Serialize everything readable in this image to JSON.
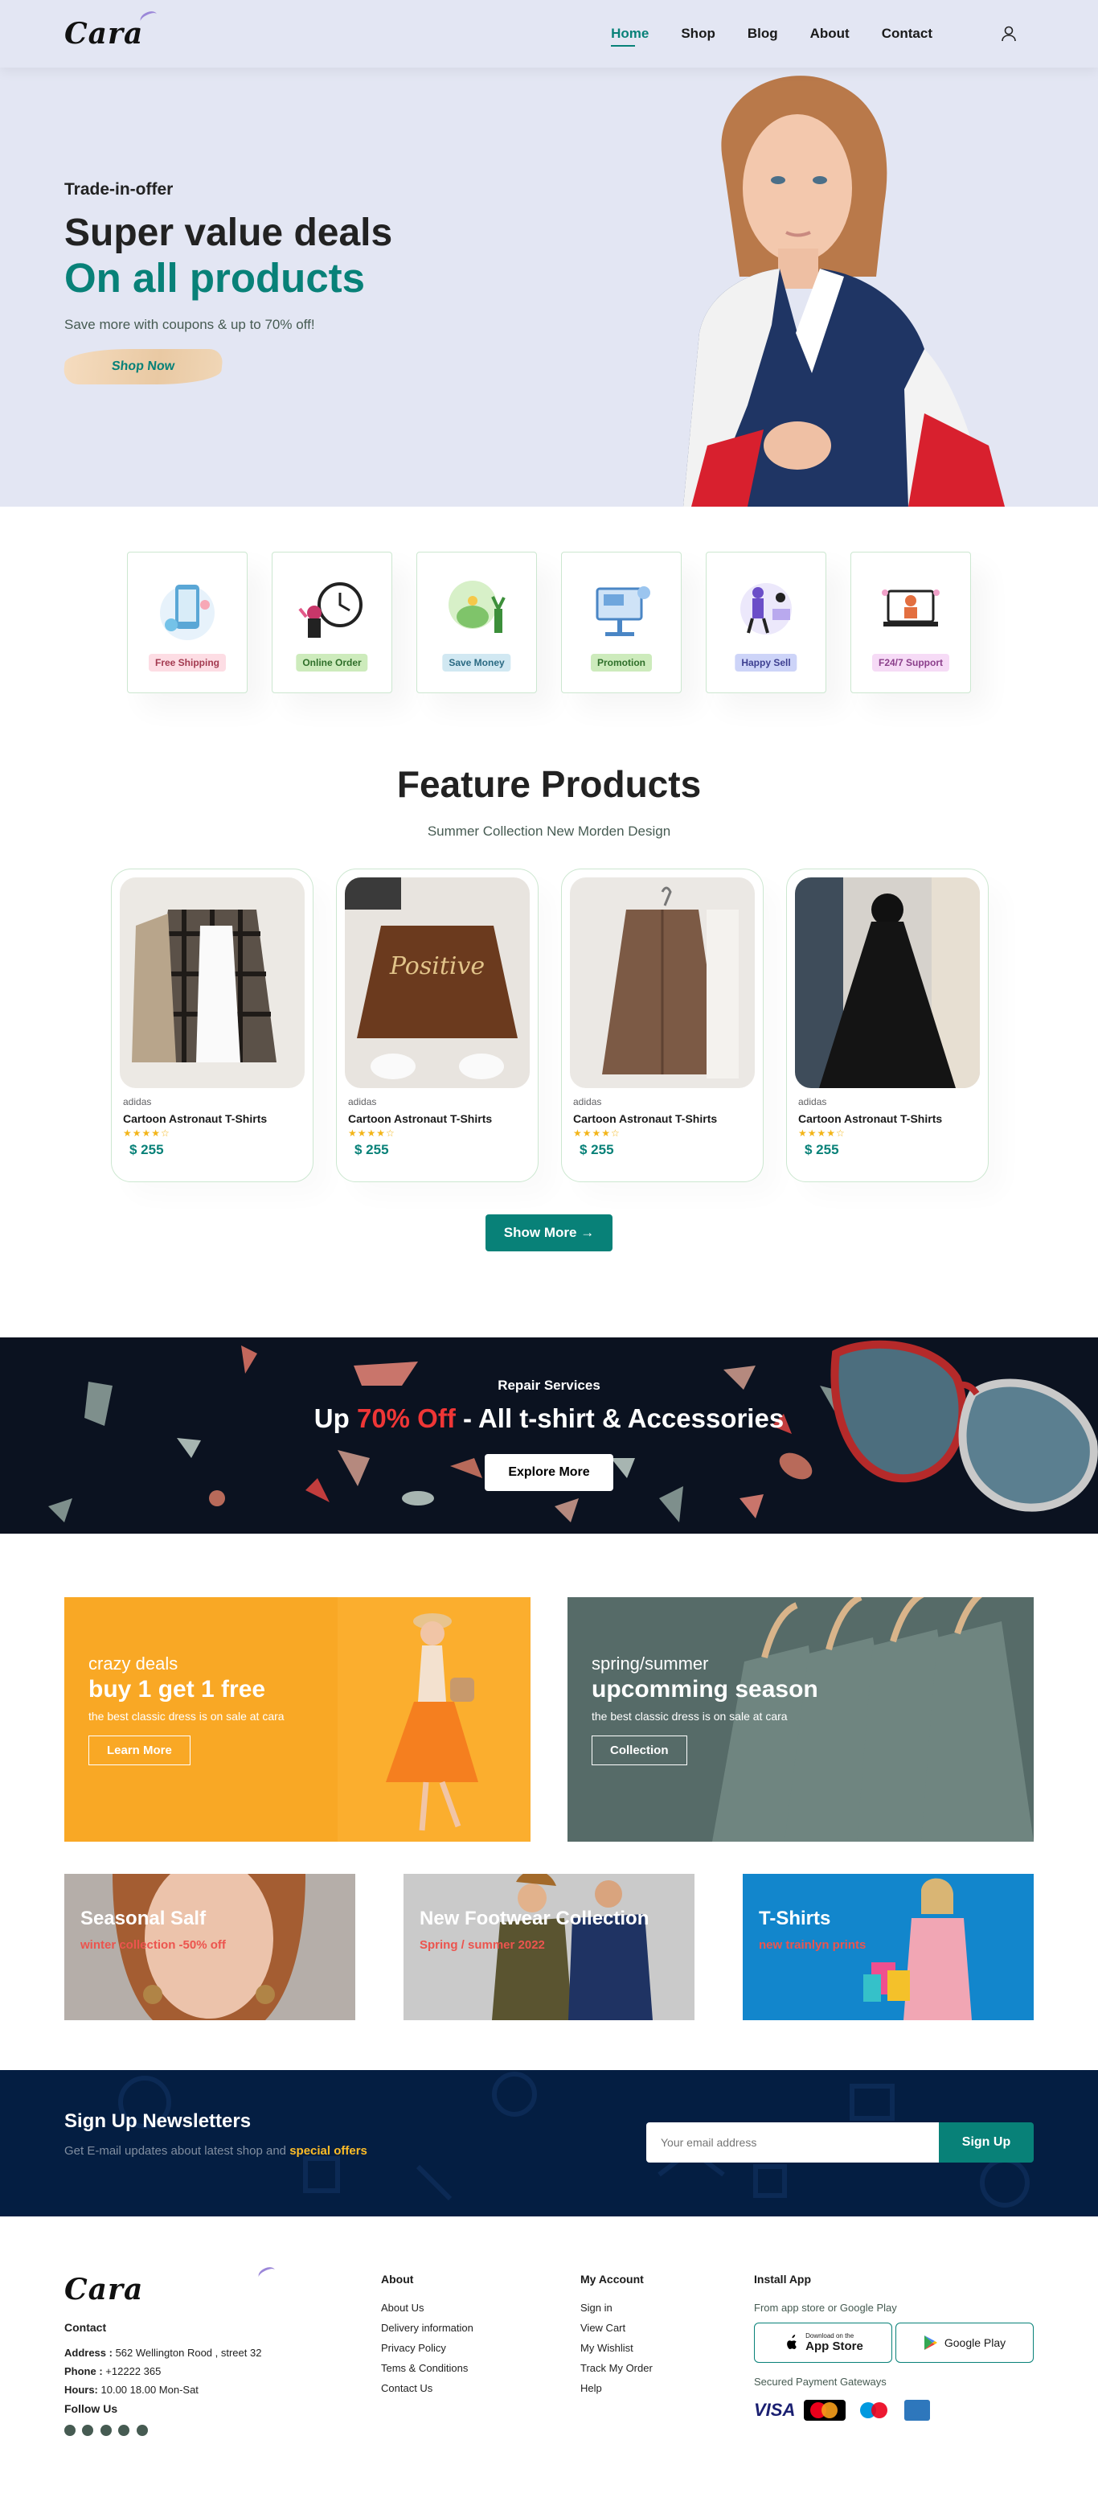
{
  "header": {
    "logo": "Cara",
    "nav": [
      {
        "label": "Home",
        "active": true
      },
      {
        "label": "Shop"
      },
      {
        "label": "Blog"
      },
      {
        "label": "About"
      },
      {
        "label": "Contact"
      }
    ],
    "user_icon": "user-icon"
  },
  "hero": {
    "kicker": "Trade-in-offer",
    "title": "Super value deals",
    "title_accent": "On all products",
    "subtitle": "Save more with coupons & up to 70% off!",
    "cta": "Shop Now"
  },
  "features": [
    {
      "label": "Free Shipping",
      "bg": "#fddde4",
      "icon": "shipping-icon"
    },
    {
      "label": "Online Order",
      "bg": "#cdebbc",
      "icon": "online-order-icon"
    },
    {
      "label": "Save Money",
      "bg": "#d1e8f2",
      "icon": "save-money-icon"
    },
    {
      "label": "Promotion",
      "bg": "#cdebbc",
      "icon": "promotion-icon"
    },
    {
      "label": "Happy Sell",
      "bg": "#cdd4f8",
      "icon": "happy-sell-icon"
    },
    {
      "label": "F24/7 Support",
      "bg": "#f6dbf6",
      "icon": "support-icon"
    }
  ],
  "products_section": {
    "title": "Feature Products",
    "subtitle": "Summer Collection New Morden Design",
    "items": [
      {
        "brand": "adidas",
        "name": "Cartoon Astronaut T-Shirts",
        "rating": 4.5,
        "price": "$ 255",
        "image": "plaid-shirt-image"
      },
      {
        "brand": "adidas",
        "name": "Cartoon Astronaut T-Shirts",
        "rating": 4.5,
        "price": "$ 255",
        "image": "positive-sweatshirt-image",
        "print": "Positive"
      },
      {
        "brand": "adidas",
        "name": "Cartoon Astronaut T-Shirts",
        "rating": 4.5,
        "price": "$ 255",
        "image": "brown-jacket-image"
      },
      {
        "brand": "adidas",
        "name": "Cartoon Astronaut T-Shirts",
        "rating": 4.5,
        "price": "$ 255",
        "image": "black-abaya-image"
      }
    ],
    "stars": "★★★★☆",
    "show_more": "Show More →"
  },
  "banner": {
    "kicker": "Repair Services",
    "title_pre": "Up ",
    "title_accent": "70% Off",
    "title_post": " - All t-shirt & Accessories",
    "cta": "Explore More"
  },
  "sm_banners": [
    {
      "kicker": "crazy deals",
      "title": "buy 1 get 1 free",
      "desc": "the best classic dress is on sale at cara",
      "cta": "Learn More",
      "bg": "#f9a825"
    },
    {
      "kicker": "spring/summer",
      "title": "upcomming season",
      "desc": "the best classic dress is on sale at cara",
      "cta": "Collection",
      "bg": "#5f7370"
    }
  ],
  "banner3": [
    {
      "title": "Seasonal Salf",
      "sub": "winter collection -50% off"
    },
    {
      "title": "New Footwear Collection",
      "sub": "Spring / summer 2022"
    },
    {
      "title": "T-Shirts",
      "sub": "new trainlyn prints"
    }
  ],
  "newsletter": {
    "title": "Sign Up Newsletters",
    "text": "Get E-mail updates about latest shop and ",
    "text_accent": "special offers",
    "placeholder": "Your email address",
    "cta": "Sign Up"
  },
  "footer": {
    "logo": "Cara",
    "contact_title": "Contact",
    "address_label": "Address :",
    "address": " 562 Wellington Rood , street 32",
    "phone_label": "Phone :",
    "phone": " +12222 365",
    "hours_label": "Hours:",
    "hours": " 10.00 18.00 Mon-Sat",
    "follow": "Follow Us",
    "about_title": "About",
    "about_links": [
      "About Us",
      "Delivery information",
      "Privacy Policy",
      "Tems & Conditions",
      "Contact Us"
    ],
    "account_title": "My Account",
    "account_links": [
      "Sign in",
      "View Cart",
      "My Wishlist",
      "Track My Order",
      "Help"
    ],
    "install_title": "Install App",
    "install_text": "From app store or Google Play",
    "appstore_small": "Download on the",
    "appstore": "App Store",
    "googleplay": "Google Play",
    "gateways": "Secured Payment Gateways",
    "payments": [
      "VISA",
      "MasterCard",
      "Maestro",
      "AMEX"
    ]
  }
}
